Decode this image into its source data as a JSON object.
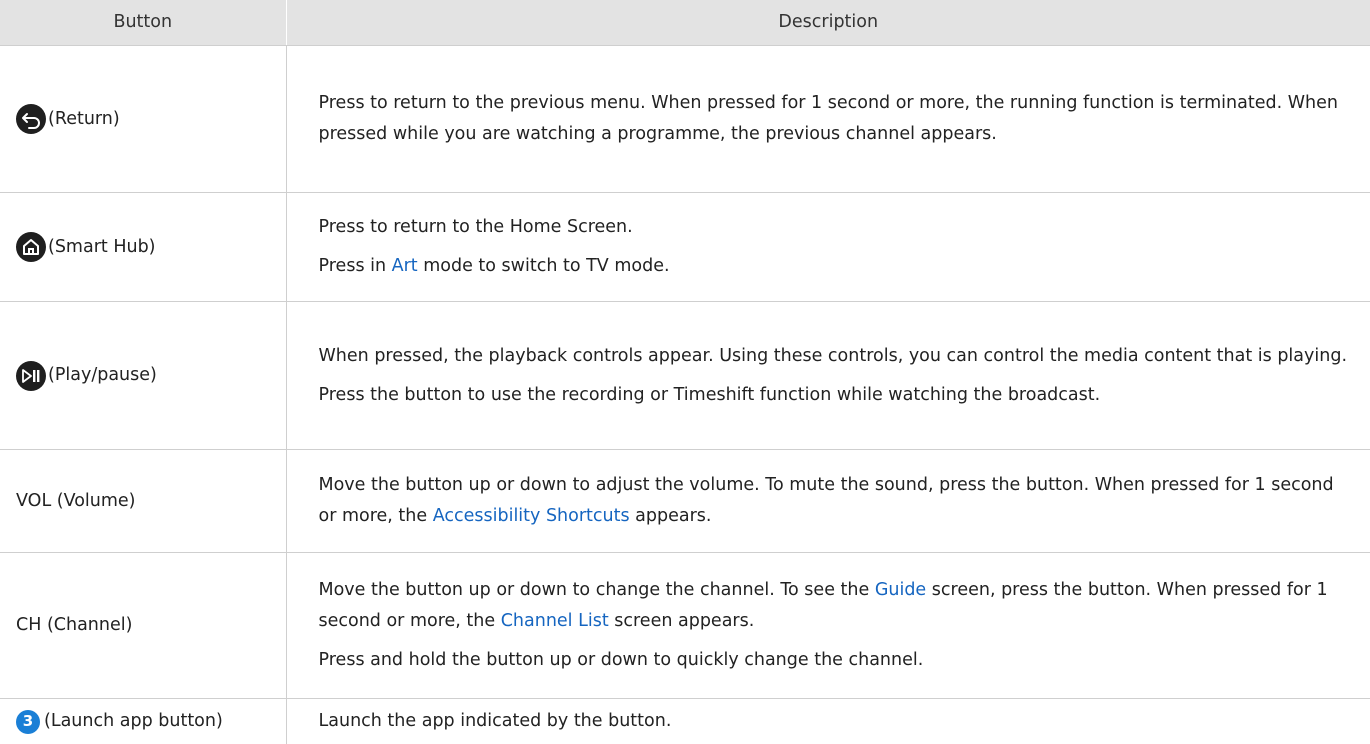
{
  "headers": {
    "button": "Button",
    "description": "Description"
  },
  "rows": {
    "return": {
      "icon": "return-arrow-icon",
      "label": "(Return)",
      "desc": "Press to return to the previous menu. When pressed for 1 second or more, the running function is terminated. When pressed while you are watching a programme, the previous channel appears."
    },
    "smarthub": {
      "icon": "home-icon",
      "label": "(Smart Hub)",
      "desc1": "Press to return to the Home Screen.",
      "desc2_pre": "Press in ",
      "desc2_link": "Art",
      "desc2_post": " mode to switch to TV mode."
    },
    "playpause": {
      "icon": "play-pause-icon",
      "label": "(Play/pause)",
      "desc1": "When pressed, the playback controls appear. Using these controls, you can control the media content that is playing.",
      "desc2": "Press the button to use the recording or Timeshift function while watching the broadcast."
    },
    "volume": {
      "label": "VOL (Volume)",
      "desc_pre": "Move the button up or down to adjust the volume. To mute the sound, press the button. When pressed for 1 second or more, the ",
      "desc_link": "Accessibility Shortcuts",
      "desc_post": " appears."
    },
    "channel": {
      "label": "CH (Channel)",
      "desc1_pre": "Move the button up or down to change the channel. To see the ",
      "desc1_link1": "Guide",
      "desc1_mid": " screen, press the button. When pressed for 1 second or more, the ",
      "desc1_link2": "Channel List",
      "desc1_post": " screen appears.",
      "desc2": "Press and hold the button up or down to quickly change the channel."
    },
    "launch": {
      "badge": "3",
      "label": "(Launch app button)",
      "desc": "Launch the app indicated by the button."
    }
  },
  "colors": {
    "header_bg": "#e3e3e3",
    "link": "#1565c0",
    "badge": "#1a7fd6",
    "icon_bg": "#1f1f1f"
  }
}
